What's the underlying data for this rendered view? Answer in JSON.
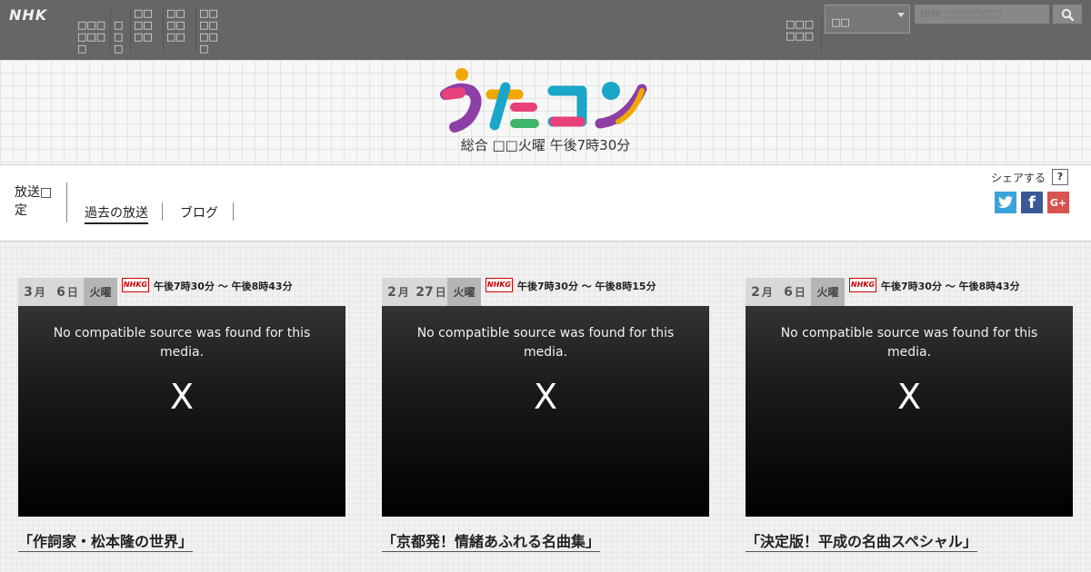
{
  "site": {
    "logo": "NHK",
    "nav": [
      "ﾃﾚﾋﾞﾗｼﾞｵ番組",
      "番組",
      "ﾆｭｰｽ天気",
      "ｽﾎﾟｰﾂ動画",
      "ｵﾝﾃﾞﾏﾝﾄﾞ",
      "受信料"
    ],
    "nav_items": [
      {
        "label": "□□□□□□□"
      },
      {
        "label": "□□□"
      },
      {
        "label": "□□□□□□"
      },
      {
        "label": "□□□□□□"
      },
      {
        "label": "□□□□□□□"
      }
    ],
    "region_label": "□□□□□□",
    "region_value": "□□",
    "search_placeholder": "NHK □□□□□□",
    "search_icon": "magnifier-icon"
  },
  "program": {
    "name": "うたコン",
    "air_time": "総合 □□火曜 午後7時30分"
  },
  "subnav": {
    "schedule": "放送□定",
    "past": "過去の放送",
    "blog": "ブログ",
    "share_label": "シェアする",
    "share_help": "?",
    "twitter_icon": "twitter-icon",
    "facebook": "f",
    "googleplus": "G+"
  },
  "channel_logo": "NHKG",
  "video_error": "No compatible source was found for this media.",
  "video_close": "X",
  "episodes": [
    {
      "month": "3",
      "month_unit": "月",
      "day": "6",
      "day_unit": "日",
      "weekday": "火曜",
      "time": "午後7時30分 〜 午後8時43分",
      "title": "「作詞家・松本隆の世界」"
    },
    {
      "month": "2",
      "month_unit": "月",
      "day": "27",
      "day_unit": "日",
      "weekday": "火曜",
      "time": "午後7時30分 〜 午後8時15分",
      "title": "「京都発！情緒あふれる名曲集」"
    },
    {
      "month": "2",
      "month_unit": "月",
      "day": "6",
      "day_unit": "日",
      "weekday": "火曜",
      "time": "午後7時30分 〜 午後8時43分",
      "title": "「決定版！平成の名曲スペシャル」"
    }
  ],
  "colors": {
    "topbar": "#666666",
    "twitter": "#3aa3dc",
    "facebook": "#3b5998",
    "googleplus": "#d9534f",
    "nhk_red": "#cc0000"
  }
}
